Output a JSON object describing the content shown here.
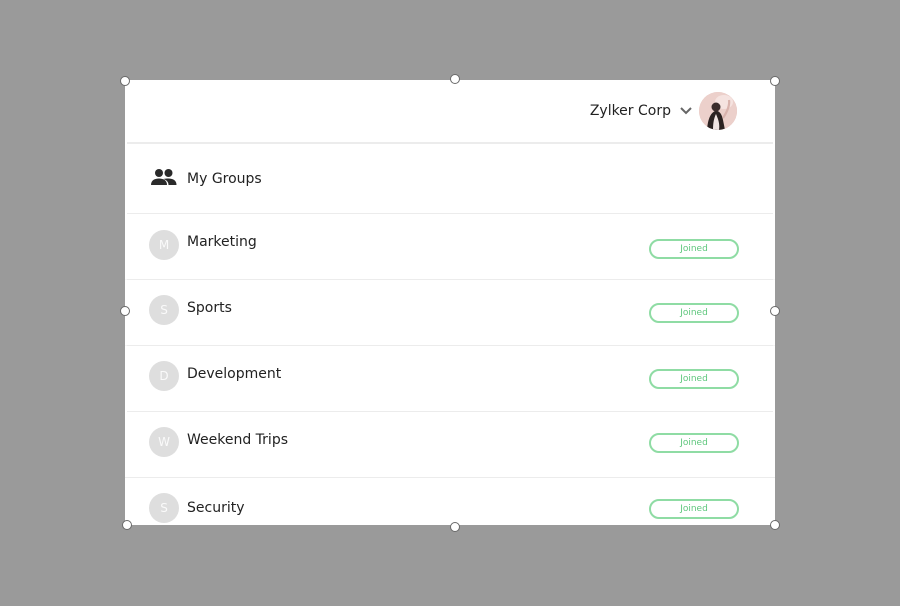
{
  "header": {
    "org_name": "Zylker Corp",
    "dropdown_icon": "chevron-down-icon",
    "avatar": "user-avatar-photo"
  },
  "section": {
    "title": "My Groups",
    "icon": "people-icon"
  },
  "groups": [
    {
      "initial": "M",
      "name": "Marketing",
      "status": "Joined"
    },
    {
      "initial": "S",
      "name": "Sports",
      "status": "Joined"
    },
    {
      "initial": "D",
      "name": "Development",
      "status": "Joined"
    },
    {
      "initial": "W",
      "name": "Weekend Trips",
      "status": "Joined"
    },
    {
      "initial": "S",
      "name": "Security",
      "status": "Joined"
    }
  ],
  "colors": {
    "backdrop": "#9a9a9a",
    "joined_badge": "#8fdca4",
    "initial_circle": "#dedede"
  }
}
